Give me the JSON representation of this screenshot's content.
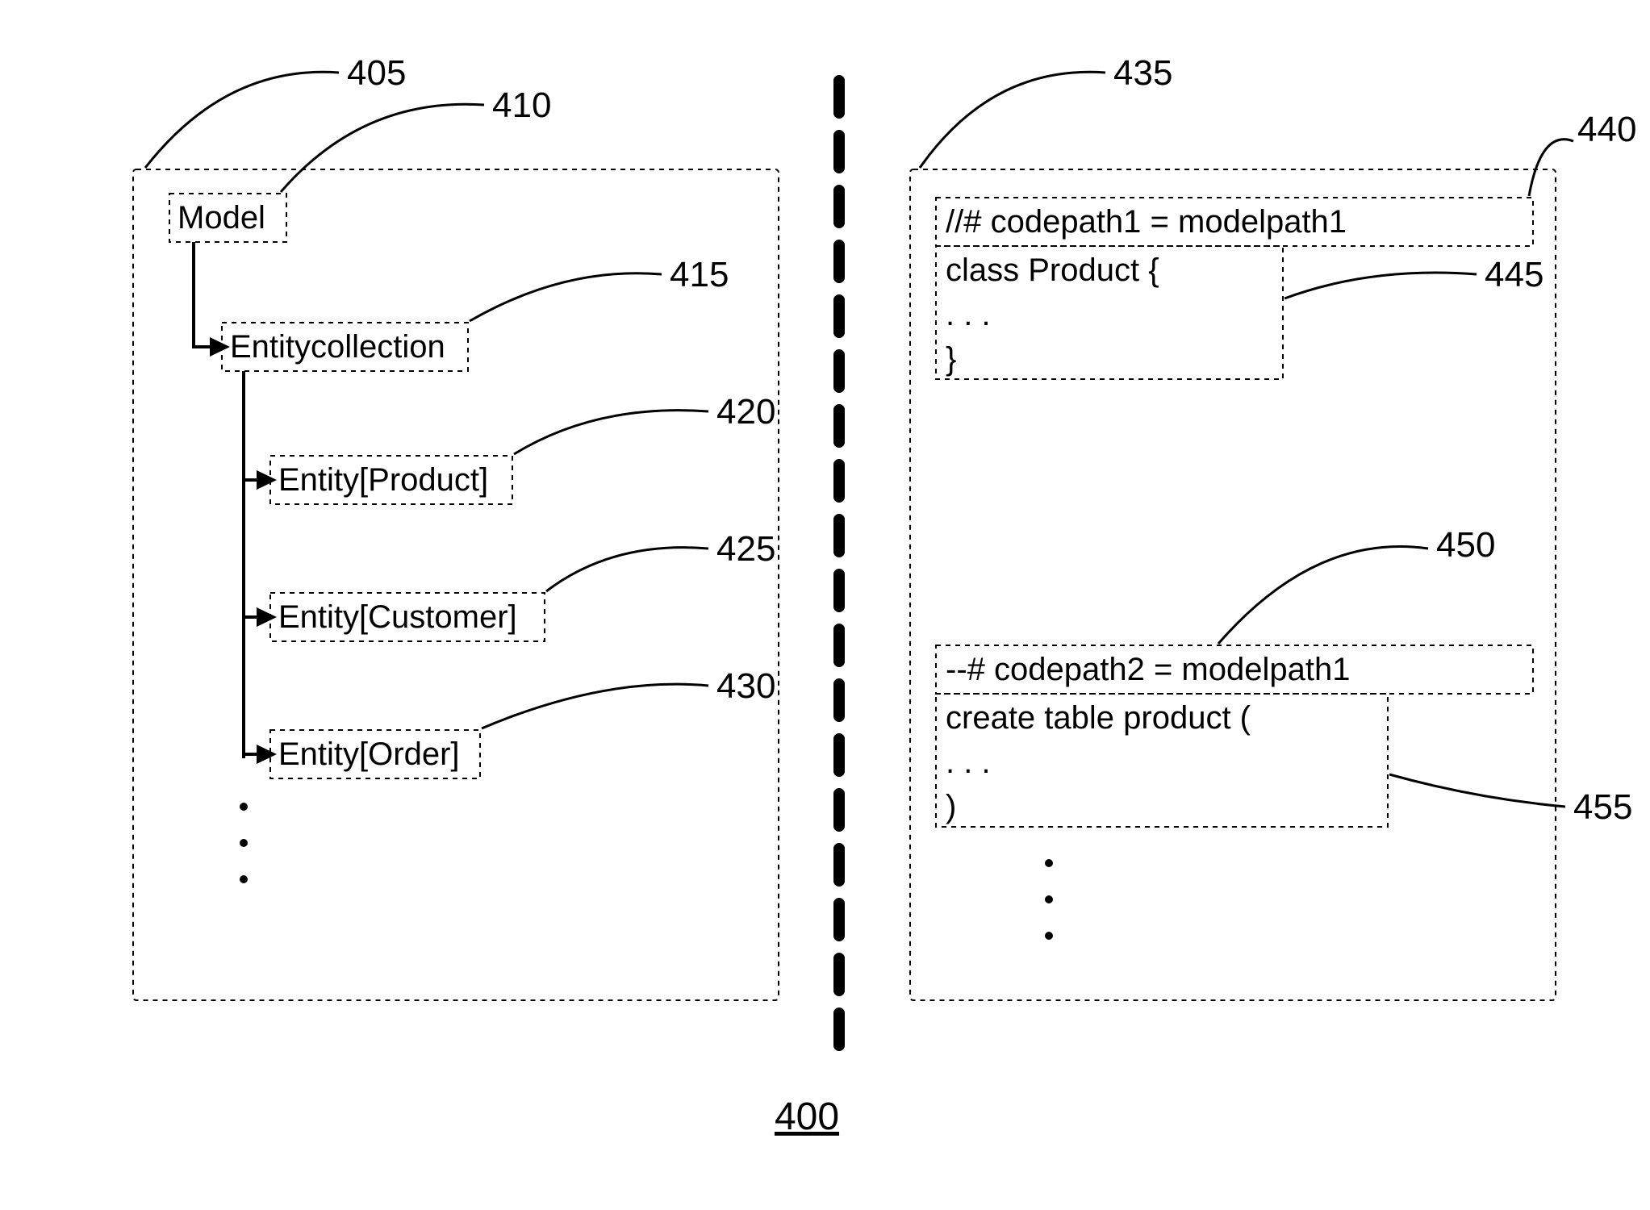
{
  "figure_number": "400",
  "refs": {
    "r405": "405",
    "r410": "410",
    "r415": "415",
    "r420": "420",
    "r425": "425",
    "r430": "430",
    "r435": "435",
    "r440": "440",
    "r445": "445",
    "r450": "450",
    "r455": "455"
  },
  "left_panel": {
    "root": "Model",
    "child": "Entitycollection",
    "entities": [
      "Entity[Product]",
      "Entity[Customer]",
      "Entity[Order]"
    ]
  },
  "right_panel": {
    "block1": {
      "annotation": "//# codepath1 = modelpath1",
      "code": "class Product {\n. . .\n}"
    },
    "block2": {
      "annotation": "--# codepath2 = modelpath1",
      "code": "create table product (\n. . .\n)"
    }
  }
}
